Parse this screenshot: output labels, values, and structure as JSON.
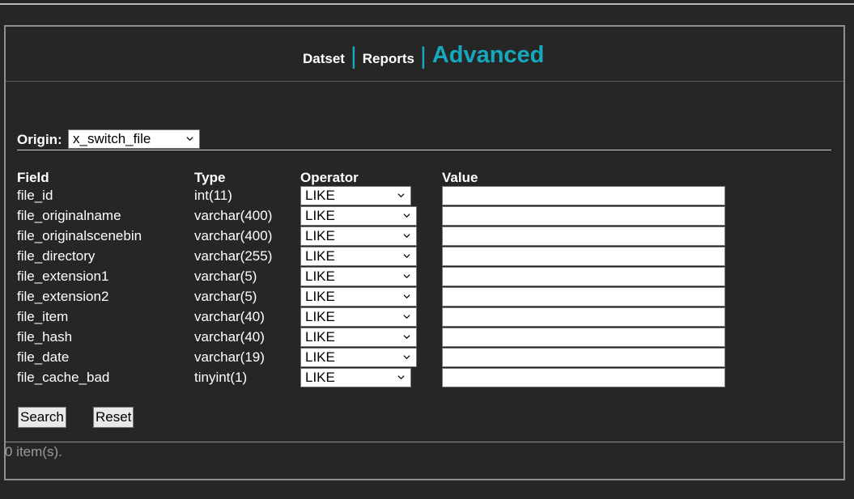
{
  "nav": {
    "items": [
      {
        "label": "Datset"
      },
      {
        "label": "Reports"
      },
      {
        "label": "Advanced"
      }
    ],
    "separator": "|"
  },
  "origin": {
    "label": "Origin:",
    "selected": "x_switch_file"
  },
  "table": {
    "headers": {
      "field": "Field",
      "type": "Type",
      "operator": "Operator",
      "value": "Value"
    },
    "rows": [
      {
        "field": "file_id",
        "type": "int(11)",
        "operator": "LIKE",
        "value": ""
      },
      {
        "field": "file_originalname",
        "type": "varchar(400)",
        "operator": "LIKE",
        "value": ""
      },
      {
        "field": "file_originalscenebin",
        "type": "varchar(400)",
        "operator": "LIKE",
        "value": ""
      },
      {
        "field": "file_directory",
        "type": "varchar(255)",
        "operator": "LIKE",
        "value": ""
      },
      {
        "field": "file_extension1",
        "type": "varchar(5)",
        "operator": "LIKE",
        "value": ""
      },
      {
        "field": "file_extension2",
        "type": "varchar(5)",
        "operator": "LIKE",
        "value": ""
      },
      {
        "field": "file_item",
        "type": "varchar(40)",
        "operator": "LIKE",
        "value": ""
      },
      {
        "field": "file_hash",
        "type": "varchar(40)",
        "operator": "LIKE",
        "value": ""
      },
      {
        "field": "file_date",
        "type": "varchar(19)",
        "operator": "LIKE",
        "value": ""
      },
      {
        "field": "file_cache_bad",
        "type": "tinyint(1)",
        "operator": "LIKE",
        "value": ""
      }
    ]
  },
  "buttons": {
    "search": "Search",
    "reset": "Reset"
  },
  "result": {
    "text": "0 item(s)."
  },
  "colors": {
    "background": "#262626",
    "accent": "#17a8bd",
    "muted_text": "#9a9a9a"
  },
  "icons": {
    "dropdown": "chevron-down-icon"
  }
}
